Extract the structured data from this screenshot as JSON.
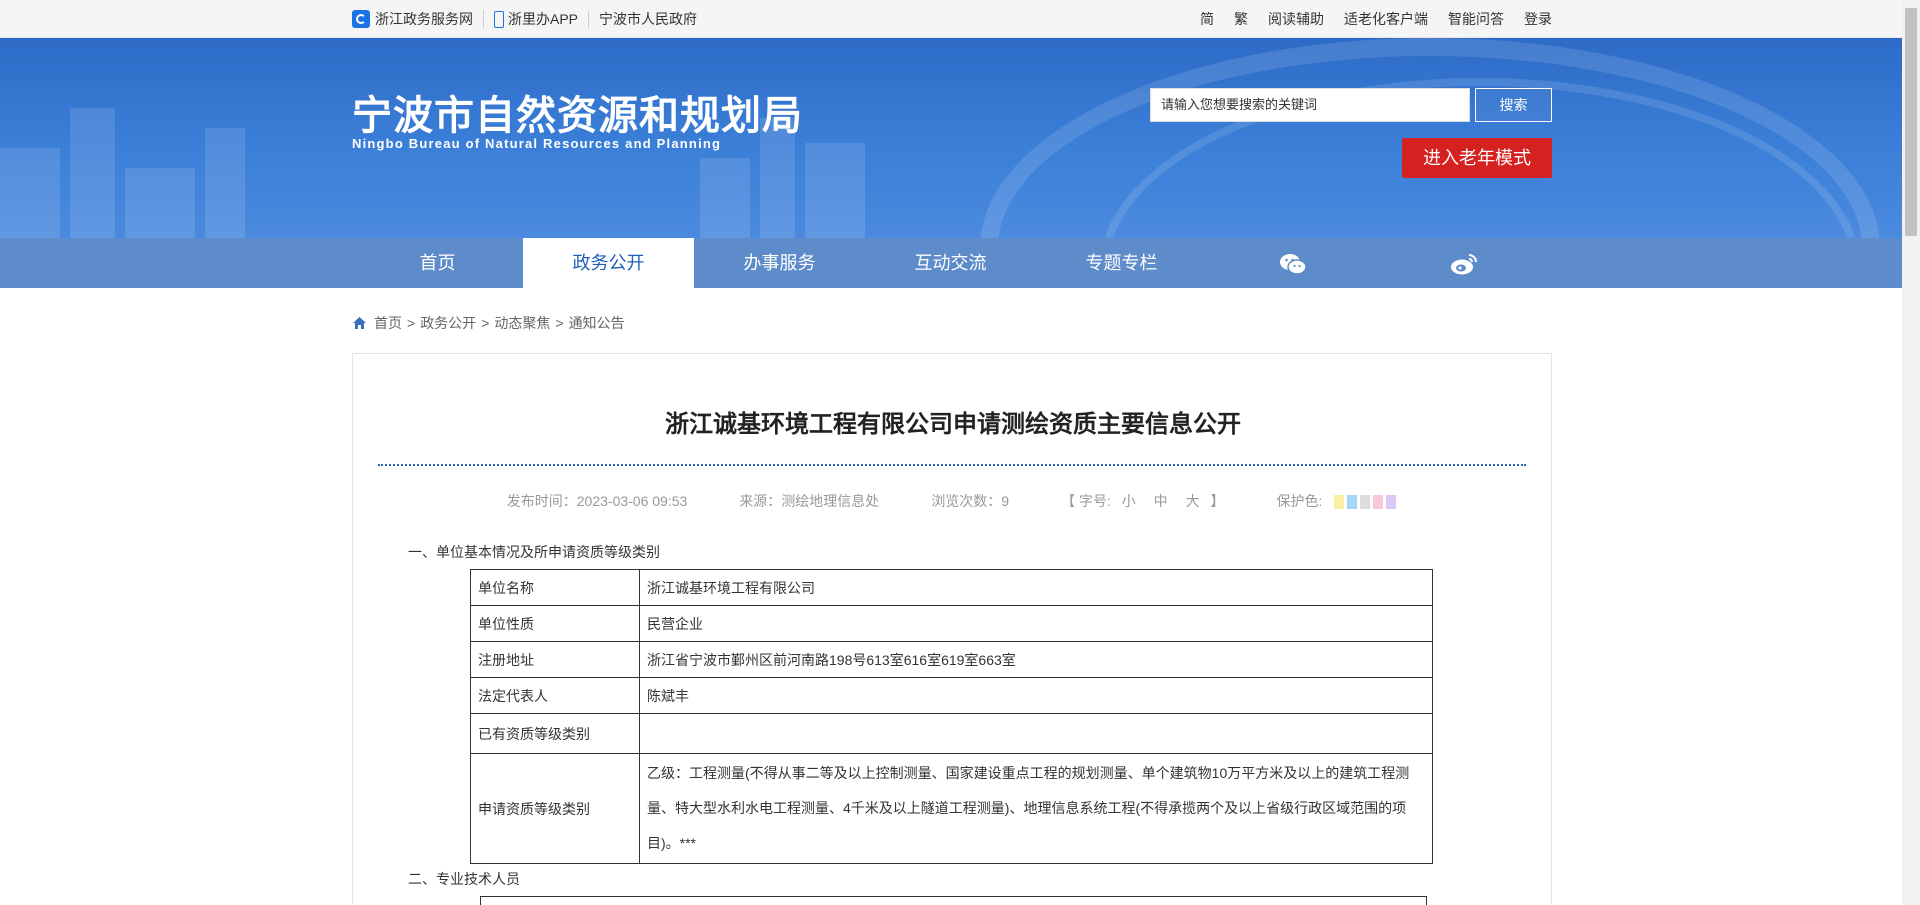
{
  "topbar": {
    "left_links": [
      "浙江政务服务网",
      "浙里办APP",
      "宁波市人民政府"
    ],
    "right_links": [
      "简",
      "繁",
      "阅读辅助",
      "适老化客户端",
      "智能问答",
      "登录"
    ]
  },
  "header": {
    "title": "宁波市自然资源和规划局",
    "subtitle": "Ningbo Bureau of Natural Resources and Planning",
    "search_placeholder": "请输入您想要搜索的关键词",
    "search_button": "搜索",
    "elder_mode_button": "进入老年模式"
  },
  "nav": {
    "items": [
      "首页",
      "政务公开",
      "办事服务",
      "互动交流",
      "专题专栏"
    ],
    "active": "政务公开",
    "icons": [
      "wechat-icon",
      "weibo-icon"
    ]
  },
  "breadcrumb": [
    "首页",
    "政务公开",
    "动态聚焦",
    "通知公告"
  ],
  "article": {
    "title": "浙江诚基环境工程有限公司申请测绘资质主要信息公开",
    "meta": {
      "publish_time": "发布时间：2023-03-06 09:53",
      "source": "来源：测绘地理信息处",
      "views": "浏览次数：9",
      "font_size_label": "【 字号:",
      "font_sizes": [
        "小",
        "中",
        "大"
      ],
      "font_size_end": "】",
      "protect_color_label": "保护色:",
      "protect_colors": [
        "#faf0a3",
        "#a5d6f5",
        "#dddddd",
        "#f6c8dc",
        "#dcc8f6"
      ]
    },
    "section1": "一、单位基本情况及所申请资质等级类别",
    "table": [
      {
        "key": "单位名称",
        "value": "浙江诚基环境工程有限公司"
      },
      {
        "key": "单位性质",
        "value": "民营企业"
      },
      {
        "key": "注册地址",
        "value": "浙江省宁波市鄞州区前河南路198号613室616室619室663室"
      },
      {
        "key": "法定代表人",
        "value": "陈斌丰"
      },
      {
        "key": "已有资质等级类别",
        "value": ""
      },
      {
        "key": "申请资质等级类别",
        "value": "乙级：工程测量(不得从事二等及以上控制测量、国家建设重点工程的规划测量、单个建筑物10万平方米及以上的建筑工程测量、特大型水利水电工程测量、4千米及以上隧道工程测量)、地理信息系统工程(不得承揽两个及以上省级行政区域范围的项目)。***"
      }
    ],
    "section2": "二、专业技术人员"
  }
}
